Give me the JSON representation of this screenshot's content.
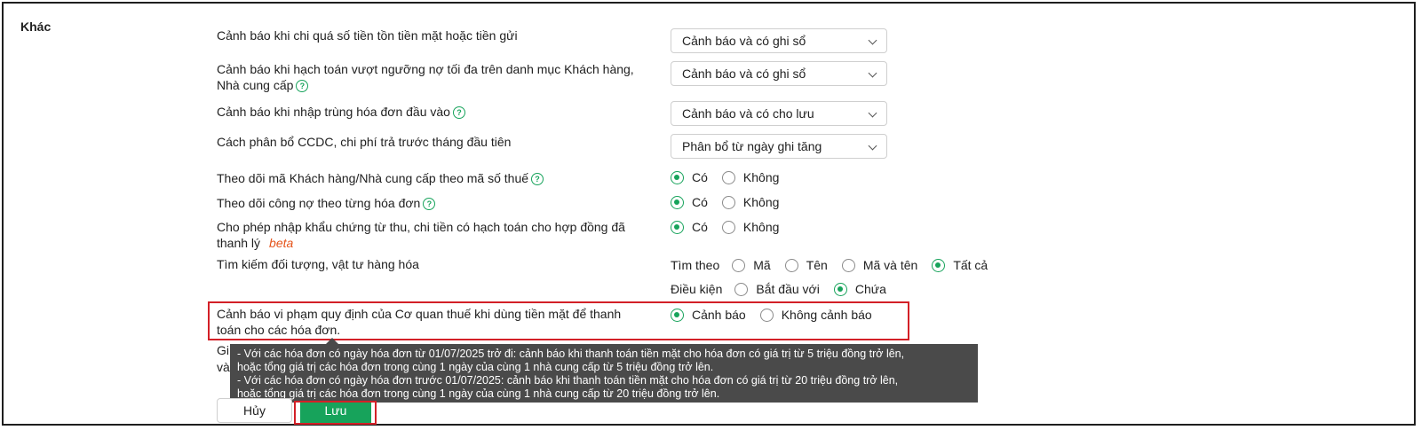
{
  "section": {
    "title": "Khác"
  },
  "rows": {
    "r1": {
      "label": "Cảnh báo khi chi quá số tiền tồn tiền mặt hoặc tiền gửi",
      "select": "Cảnh báo và có ghi sổ"
    },
    "r2": {
      "label": "Cảnh báo khi hạch toán vượt ngưỡng nợ tối đa trên danh mục Khách hàng, Nhà cung cấp",
      "select": "Cảnh báo và có ghi sổ"
    },
    "r3": {
      "label": "Cảnh báo khi nhập trùng hóa đơn đầu vào",
      "select": "Cảnh báo và có cho lưu"
    },
    "r4": {
      "label": "Cách phân bổ CCDC, chi phí trả trước tháng đầu tiên",
      "select": "Phân bổ từ ngày ghi tăng"
    },
    "r5": {
      "label": "Theo dõi mã Khách hàng/Nhà cung cấp theo mã số thuế",
      "opt_yes": "Có",
      "opt_no": "Không",
      "selected": "Có"
    },
    "r6": {
      "label": "Theo dõi công nợ theo từng hóa đơn",
      "opt_yes": "Có",
      "opt_no": "Không",
      "selected": "Có"
    },
    "r7": {
      "label": "Cho phép nhập khẩu chứng từ thu, chi tiền có hạch toán cho hợp đồng đã thanh lý",
      "beta": "beta",
      "opt_yes": "Có",
      "opt_no": "Không",
      "selected": "Có"
    },
    "r8": {
      "label": "Tìm kiếm đối tượng, vật tư hàng hóa",
      "search_by_label": "Tìm theo",
      "search_by_options": [
        "Mã",
        "Tên",
        "Mã và tên",
        "Tất cả"
      ],
      "search_by_selected": "Tất cả",
      "condition_label": "Điều kiện",
      "condition_options": [
        "Bắt đầu với",
        "Chứa"
      ],
      "condition_selected": "Chứa"
    },
    "r9": {
      "label": "Cảnh báo vi phạm quy định của Cơ quan thuế khi dùng tiền mặt để thanh toán cho các hóa đơn.",
      "opt_warn": "Cảnh báo",
      "opt_nowarn": "Không cảnh báo",
      "selected": "Cảnh báo"
    },
    "r10": {
      "label_line1": "Gi",
      "label_line2": "và"
    }
  },
  "tooltip": {
    "line1": "- Với các hóa đơn có ngày hóa đơn từ 01/07/2025 trở đi: cảnh báo khi thanh toán tiền mặt cho hóa đơn có giá trị từ 5 triệu đồng trở lên,",
    "line2": "hoặc tổng giá trị các hóa đơn trong cùng 1 ngày của cùng 1 nhà cung cấp từ 5 triệu đồng trở lên.",
    "line3": "- Với các hóa đơn có ngày hóa đơn trước 01/07/2025: cảnh báo khi thanh toán tiền mặt cho hóa đơn có giá trị từ 20 triệu đồng trở lên,",
    "line4": "hoặc tổng giá trị các hóa đơn trong cùng 1 ngày của cùng 1 nhà cung cấp từ 20 triệu đồng trở lên."
  },
  "buttons": {
    "cancel": "Hủy",
    "save": "Lưu"
  },
  "colors": {
    "accent": "#17a35b",
    "highlight": "#d32027",
    "beta": "#e5531a",
    "tooltip_bg": "#4a4a4a"
  },
  "icons": {
    "help": "help-circle-icon",
    "dropdown": "chevron-down-icon"
  }
}
